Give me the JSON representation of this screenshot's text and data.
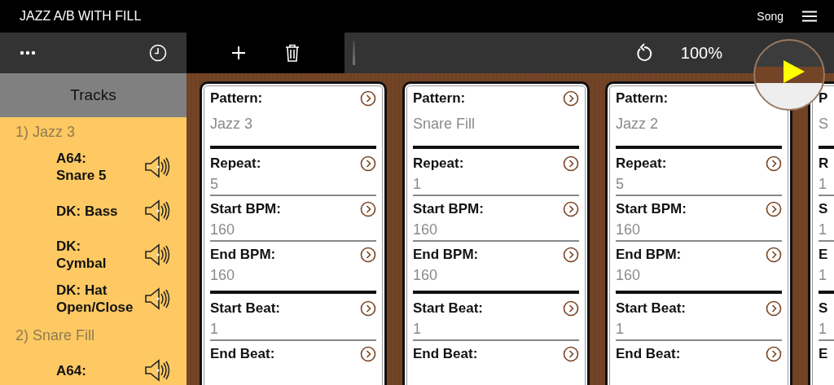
{
  "window": {
    "title": "JAZZ A/B WITH FILL",
    "mode": "Song"
  },
  "toolbar": {
    "zoom": "100%"
  },
  "sidebar": {
    "header": "Tracks",
    "groups": [
      {
        "label": "1) Jazz 3",
        "children": [
          {
            "label": "A64:\nSnare 5"
          },
          {
            "label": "DK: Bass"
          },
          {
            "label": "DK:\nCymbal"
          },
          {
            "label": "DK: Hat\nOpen/Close"
          }
        ]
      },
      {
        "label": "2) Snare Fill",
        "children": [
          {
            "label": "A64:"
          }
        ]
      }
    ]
  },
  "cards": [
    {
      "fields": [
        {
          "label": "Pattern:",
          "value": "Jazz 3",
          "arrow": true,
          "heavy_rule": true
        },
        {
          "label": "Repeat:",
          "value": "5",
          "arrow": true,
          "heavy_rule": false
        },
        {
          "label": "Start BPM:",
          "value": "160",
          "arrow": true,
          "heavy_rule": false
        },
        {
          "label": "End BPM:",
          "value": "160",
          "arrow": true,
          "heavy_rule": true
        },
        {
          "label": "Start Beat:",
          "value": "1",
          "arrow": true,
          "heavy_rule": false
        },
        {
          "label": "End Beat:",
          "arrow": true
        }
      ]
    },
    {
      "fields": [
        {
          "label": "Pattern:",
          "value": "Snare Fill",
          "arrow": true,
          "heavy_rule": true
        },
        {
          "label": "Repeat:",
          "value": "1",
          "arrow": true,
          "heavy_rule": false
        },
        {
          "label": "Start BPM:",
          "value": "160",
          "arrow": true,
          "heavy_rule": false
        },
        {
          "label": "End BPM:",
          "value": "160",
          "arrow": true,
          "heavy_rule": true
        },
        {
          "label": "Start Beat:",
          "value": "1",
          "arrow": true,
          "heavy_rule": false
        },
        {
          "label": "End Beat:",
          "arrow": true
        }
      ]
    },
    {
      "fields": [
        {
          "label": "Pattern:",
          "value": "Jazz 2",
          "arrow": false,
          "heavy_rule": true
        },
        {
          "label": "Repeat:",
          "value": "5",
          "arrow": true,
          "heavy_rule": false
        },
        {
          "label": "Start BPM:",
          "value": "160",
          "arrow": true,
          "heavy_rule": false
        },
        {
          "label": "End BPM:",
          "value": "160",
          "arrow": true,
          "heavy_rule": true
        },
        {
          "label": "Start Beat:",
          "value": "1",
          "arrow": true,
          "heavy_rule": false
        },
        {
          "label": "End Beat:",
          "arrow": true
        }
      ]
    },
    {
      "fields": [
        {
          "label": "P",
          "value": "S",
          "arrow": false,
          "heavy_rule": true
        },
        {
          "label": "R",
          "value": "1",
          "arrow": false,
          "heavy_rule": false
        },
        {
          "label": "S",
          "value": "1",
          "arrow": false,
          "heavy_rule": false
        },
        {
          "label": "E",
          "value": "1",
          "arrow": false,
          "heavy_rule": true
        },
        {
          "label": "S",
          "value": "1",
          "arrow": false,
          "heavy_rule": false
        },
        {
          "label": "E",
          "arrow": false
        }
      ]
    }
  ]
}
